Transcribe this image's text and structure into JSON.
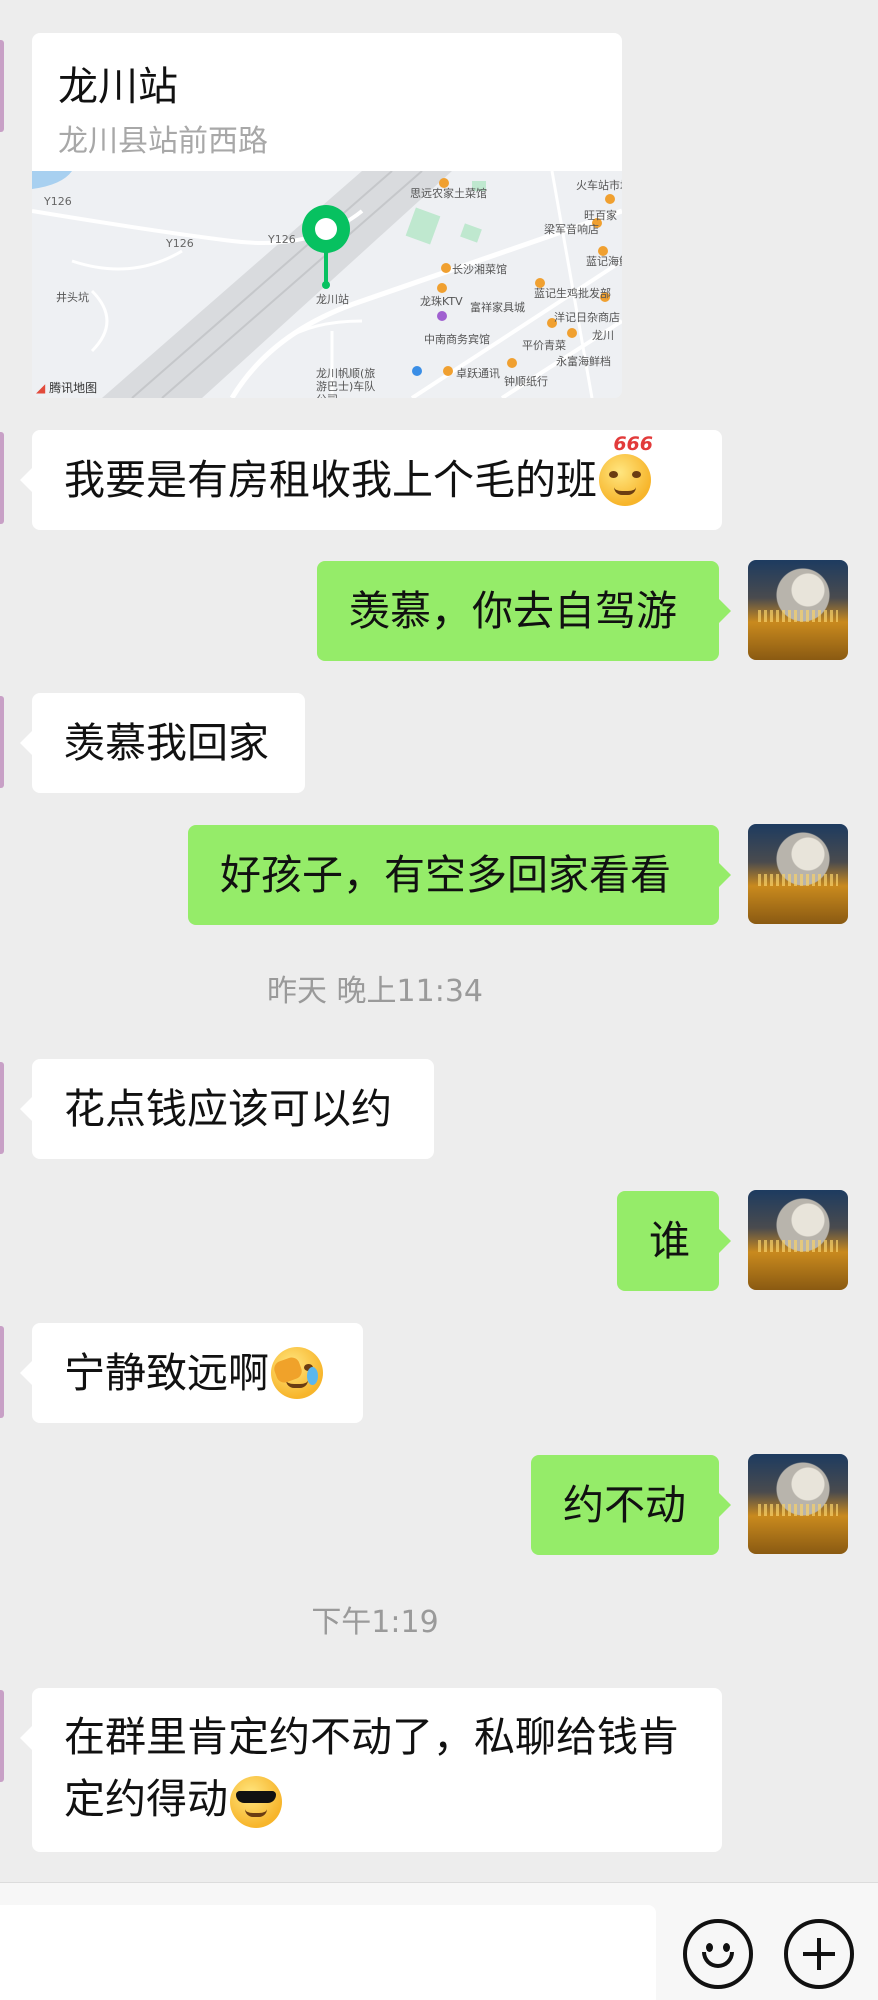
{
  "location": {
    "title": "龙川站",
    "address": "龙川县站前西路",
    "map_provider": "腾讯地图",
    "map_labels": {
      "pin": "龙川站",
      "road1": "Y126",
      "road2": "Y126",
      "road3": "Y126",
      "village": "井头坑",
      "p1": "思远农家土菜馆",
      "p2": "火车站市场",
      "p3": "旺百家",
      "p4": "梁军音响店",
      "p5": "蓝记海鲜",
      "p6": "长沙湘菜馆",
      "p7": "龙珠KTV",
      "p8": "富祥家具城",
      "p9": "蓝记生鸡批发部",
      "p10": "洋记日杂商店",
      "p11": "中南商务宾馆",
      "p12": "平价青菜",
      "p13": "永富海鲜档",
      "p14": "龙川帆顺(旅游巴士)车队公司",
      "p15": "卓跃通讯",
      "p16": "钟顺纸行",
      "p17": "龙川"
    }
  },
  "messages": [
    {
      "id": "m1",
      "side": "in",
      "text": "我要是有房租收我上个毛的班",
      "emoji": "smirk-666",
      "emoji_badge": "666"
    },
    {
      "id": "m2",
      "side": "out",
      "text": "羡慕，你去自驾游"
    },
    {
      "id": "m3",
      "side": "in",
      "text": "羡慕我回家"
    },
    {
      "id": "m4",
      "side": "out",
      "text": "好孩子，有空多回家看看"
    },
    {
      "id": "m5",
      "side": "in",
      "text": "花点钱应该可以约"
    },
    {
      "id": "m6",
      "side": "out",
      "text": "谁"
    },
    {
      "id": "m7",
      "side": "in",
      "text": "宁静致远啊",
      "emoji": "facepalm"
    },
    {
      "id": "m8",
      "side": "out",
      "text": "约不动"
    },
    {
      "id": "m9",
      "side": "in",
      "text_line1": "在群里肯定约不动了，私聊给钱肯",
      "text_line2": "定约得动",
      "emoji": "cool-sunglasses"
    }
  ],
  "timestamps": {
    "t1": "昨天 晚上11:34",
    "t2": "下午1:19"
  },
  "input_bar": {
    "emoji_icon": "smile-icon",
    "plus_icon": "plus-circle-icon"
  },
  "colors": {
    "background": "#ededed",
    "incoming_bubble": "#ffffff",
    "outgoing_bubble": "#95ec69",
    "map_pin": "#07c160"
  }
}
